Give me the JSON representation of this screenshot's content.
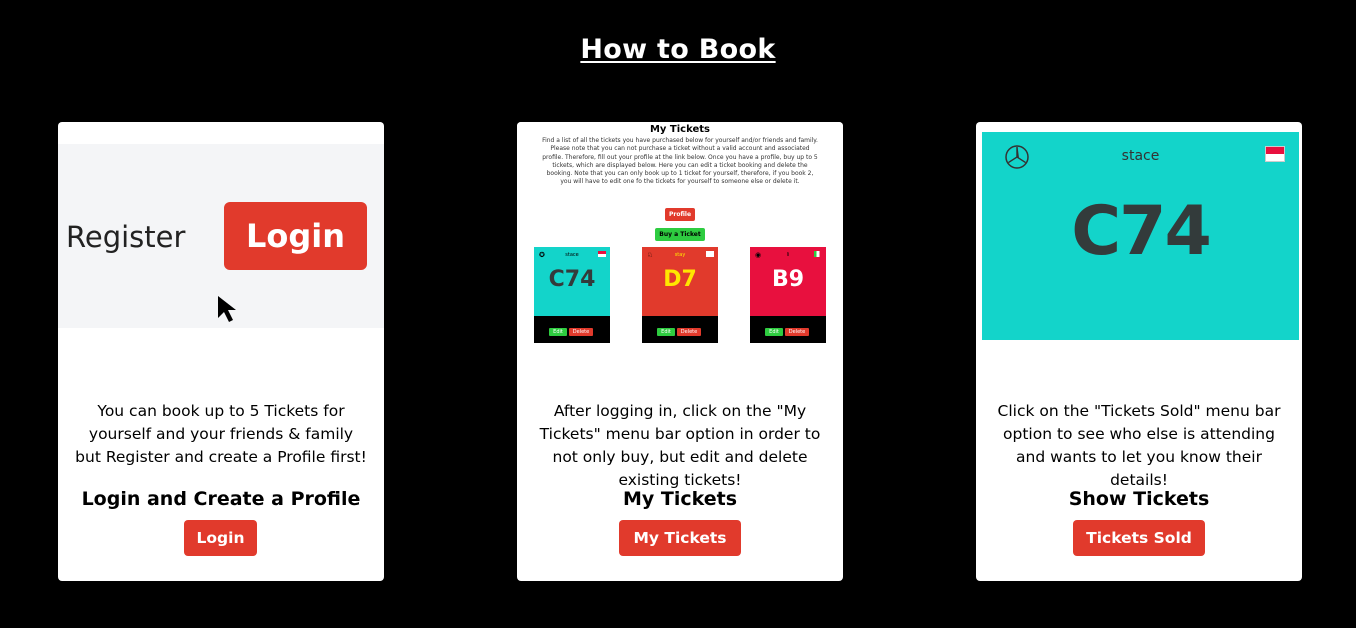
{
  "heading": "How to Book",
  "cards": [
    {
      "title": "Login and Create a Profile",
      "text": "You can book up to 5 Tickets for yourself and your friends & family but Register and create a Profile first!",
      "button": "Login",
      "image": {
        "register_label": "Register",
        "login_label": "Login"
      }
    },
    {
      "title": "My Tickets",
      "text": "After logging in, click on the \"My Tickets\" menu bar option in order to not only buy, but edit and delete existing tickets!",
      "button": "My Tickets",
      "image": {
        "title": "My Tickets",
        "description": "Find a list of all the tickets you have purchased below for yourself and/or friends and family. Please note that you can not purchase a ticket without a valid account and associated profile. Therefore, fill out your profile at the link below. Once you have a profile, buy up to 5 tickets, which are displayed below. Here you can edit a ticket booking and delete the booking. Note that you can only book up to 1 ticket for yourself, therefore, if you book 2, you will have to edit one fo the tickets for yourself to someone else or delete it.",
        "profile_button": "Profile",
        "buy_button": "Buy a Ticket",
        "tickets": [
          {
            "team": "stace",
            "code": "C74",
            "bg": "#13d4ca",
            "code_color": "#333b3b",
            "edit": "Edit",
            "delete": "Delete"
          },
          {
            "team": "stay",
            "code": "D7",
            "bg": "#e13a2c",
            "code_color": "#ffe600",
            "edit": "Edit",
            "delete": "Delete"
          },
          {
            "team": "li",
            "code": "B9",
            "bg": "#e8103e",
            "code_color": "#ffffff",
            "edit": "Edit",
            "delete": "Delete"
          }
        ]
      }
    },
    {
      "title": "Show Tickets",
      "text": "Click on the \"Tickets Sold\" menu bar option to see who else is attending and wants to let you know their details!",
      "button": "Tickets Sold",
      "image": {
        "team": "stace",
        "code": "C74"
      }
    }
  ],
  "colors": {
    "accent": "#e13a2c",
    "green": "#2ecc40",
    "teal": "#13d4ca",
    "background": "#000000"
  }
}
